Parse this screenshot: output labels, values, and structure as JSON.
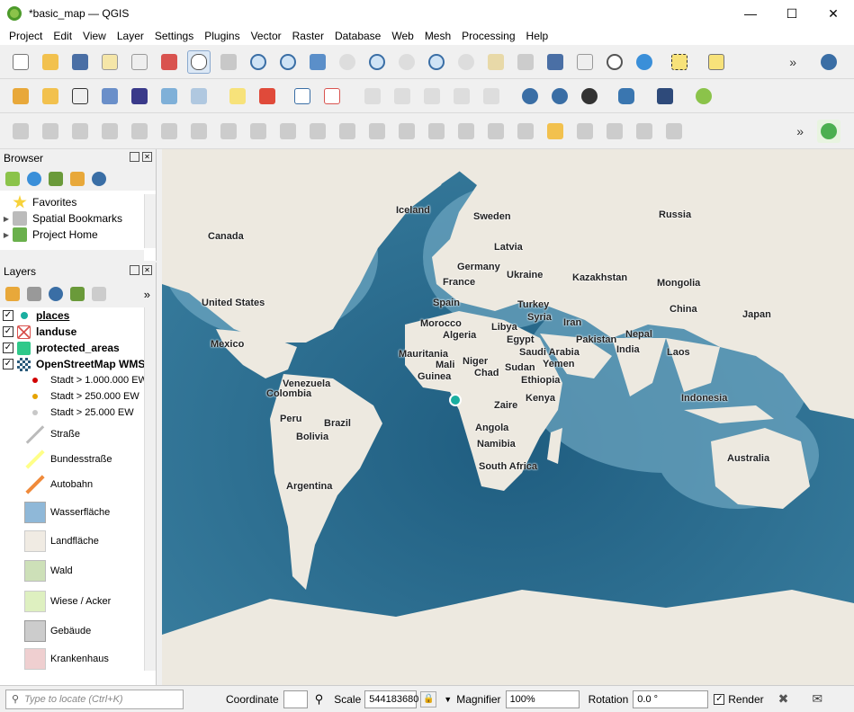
{
  "window": {
    "title": "*basic_map — QGIS"
  },
  "menu": [
    "Project",
    "Edit",
    "View",
    "Layer",
    "Settings",
    "Plugins",
    "Vector",
    "Raster",
    "Database",
    "Web",
    "Mesh",
    "Processing",
    "Help"
  ],
  "browser": {
    "title": "Browser",
    "items": [
      {
        "label": "Favorites",
        "icon": "star-icon"
      },
      {
        "label": "Spatial Bookmarks",
        "icon": "bookmark-icon"
      },
      {
        "label": "Project Home",
        "icon": "home-folder-icon"
      }
    ]
  },
  "layers": {
    "title": "Layers",
    "items": [
      {
        "label": "places",
        "icon": "point-layer-icon",
        "checked": true,
        "underline": true
      },
      {
        "label": "landuse",
        "icon": "polygon-layer-icon",
        "checked": true
      },
      {
        "label": "protected_areas",
        "icon": "polygon-green-layer-icon",
        "checked": true
      },
      {
        "label": "OpenStreetMap WMS",
        "icon": "raster-layer-icon",
        "checked": true
      }
    ],
    "legend": [
      {
        "label": "Stadt > 1.000.000 EW",
        "color": "#d10000",
        "kind": "dot"
      },
      {
        "label": "Stadt > 250.000 EW",
        "color": "#e6a300",
        "kind": "dot"
      },
      {
        "label": "Stadt > 25.000 EW",
        "color": "#c8c8c8",
        "kind": "dot"
      },
      {
        "label": "Straße",
        "color": "#bbbbbb",
        "kind": "line"
      },
      {
        "label": "Bundesstraße",
        "color": "#ffff88",
        "kind": "line"
      },
      {
        "label": "Autobahn",
        "color": "#f08a3a",
        "kind": "line"
      },
      {
        "label": "Wasserfläche",
        "color": "#8fb8d8",
        "kind": "fill"
      },
      {
        "label": "Landfläche",
        "color": "#f0ebe3",
        "kind": "fill"
      },
      {
        "label": "Wald",
        "color": "#cde0b8",
        "kind": "fill"
      },
      {
        "label": "Wiese / Acker",
        "color": "#def0c0",
        "kind": "fill"
      },
      {
        "label": "Gebäude",
        "color": "#cccccc",
        "kind": "fill"
      },
      {
        "label": "Krankenhaus",
        "color": "#efcfd0",
        "kind": "fill"
      }
    ]
  },
  "map_labels": [
    "Iceland",
    "Sweden",
    "Russia",
    "Canada",
    "Latvia",
    "Germany",
    "Ukraine",
    "Kazakhstan",
    "France",
    "Mongolia",
    "United States",
    "Spain",
    "Turkey",
    "Syria",
    "China",
    "Morocco",
    "Libya",
    "Iran",
    "Japan",
    "Algeria",
    "Egypt",
    "Nepal",
    "Pakistan",
    "Mexico",
    "Mauritania",
    "Saudi Arabia",
    "India",
    "Mali",
    "Niger",
    "Yemen",
    "Laos",
    "Guinea",
    "Chad",
    "Sudan",
    "Ethiopia",
    "Venezuela",
    "Colombia",
    "Kenya",
    "Indonesia",
    "Zaire",
    "Peru",
    "Brazil",
    "Bolivia",
    "Angola",
    "Namibia",
    "South Africa",
    "Australia",
    "Argentina"
  ],
  "status": {
    "locate_placeholder": "Type to locate (Ctrl+K)",
    "coordinate_label": "Coordinate",
    "coordinate_value": "",
    "scale_label": "Scale",
    "scale_value": "544183680",
    "magnifier_label": "Magnifier",
    "magnifier_value": "100%",
    "rotation_label": "Rotation",
    "rotation_value": "0.0 °",
    "render_label": "Render"
  },
  "colors": {
    "ocean_deep": "#2a6a8c",
    "ocean_shallow": "#7fb0c8",
    "land": "#ede9e0"
  }
}
